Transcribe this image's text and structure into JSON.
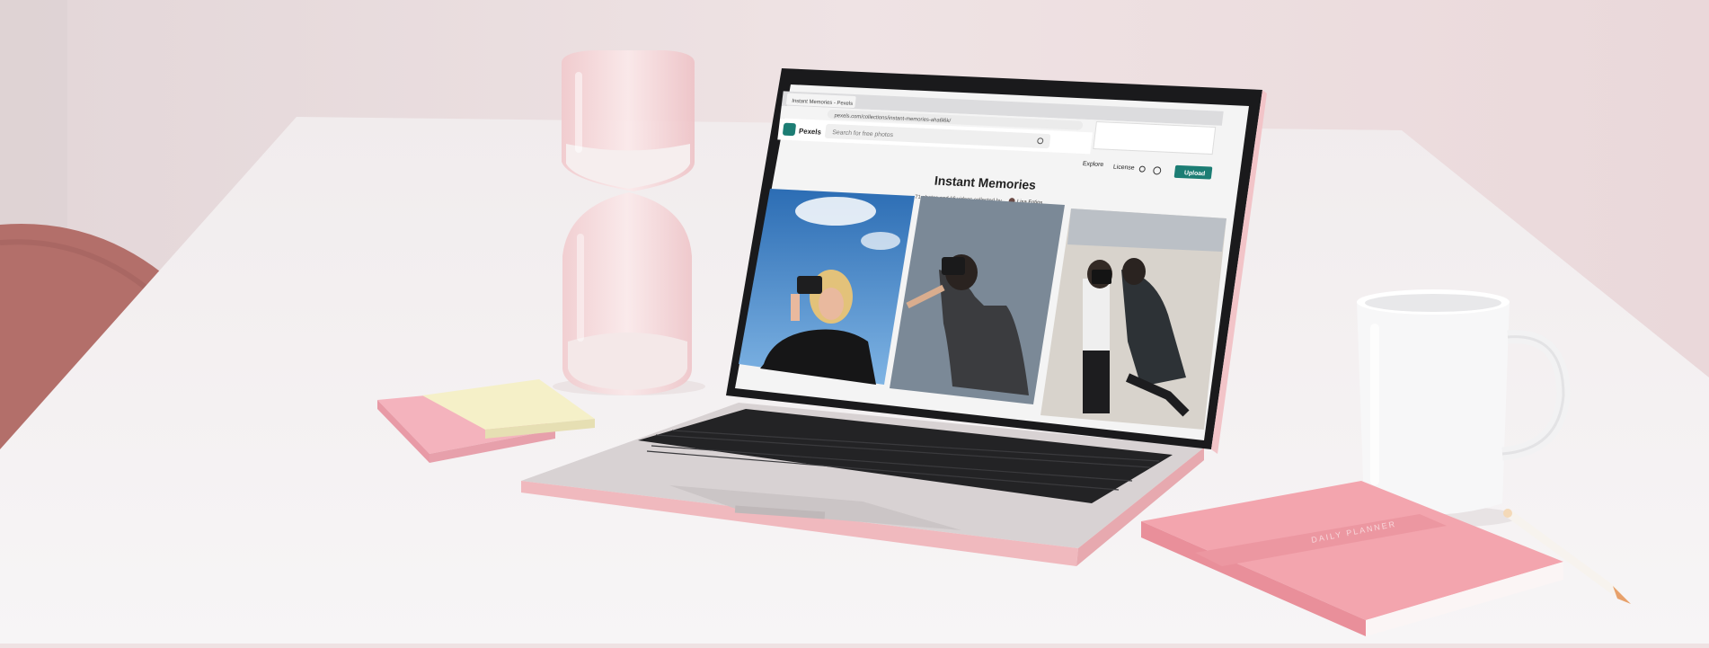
{
  "browser": {
    "tab_title": "Instant Memories - Pexels",
    "address": "pexels.com/collections/instant-memories-aha6l6k/"
  },
  "pexels": {
    "logo_text": "Pexels",
    "search_placeholder": "Search for free photos",
    "nav": [
      "Explore",
      "License"
    ],
    "upload_label": "Upload"
  },
  "collection": {
    "title": "Instant Memories",
    "meta": "71 photos and 16 videos collected by",
    "author": "Lisa Fotios"
  },
  "notebook": {
    "label": "DAILY PLANNER"
  },
  "colors": {
    "wall": "#efe2e3",
    "table": "#f4f1f2",
    "laptop_shell": "#e9b8bd",
    "notebook_pink": "#f2a4ad",
    "pexels_teal": "#1c7d74"
  }
}
